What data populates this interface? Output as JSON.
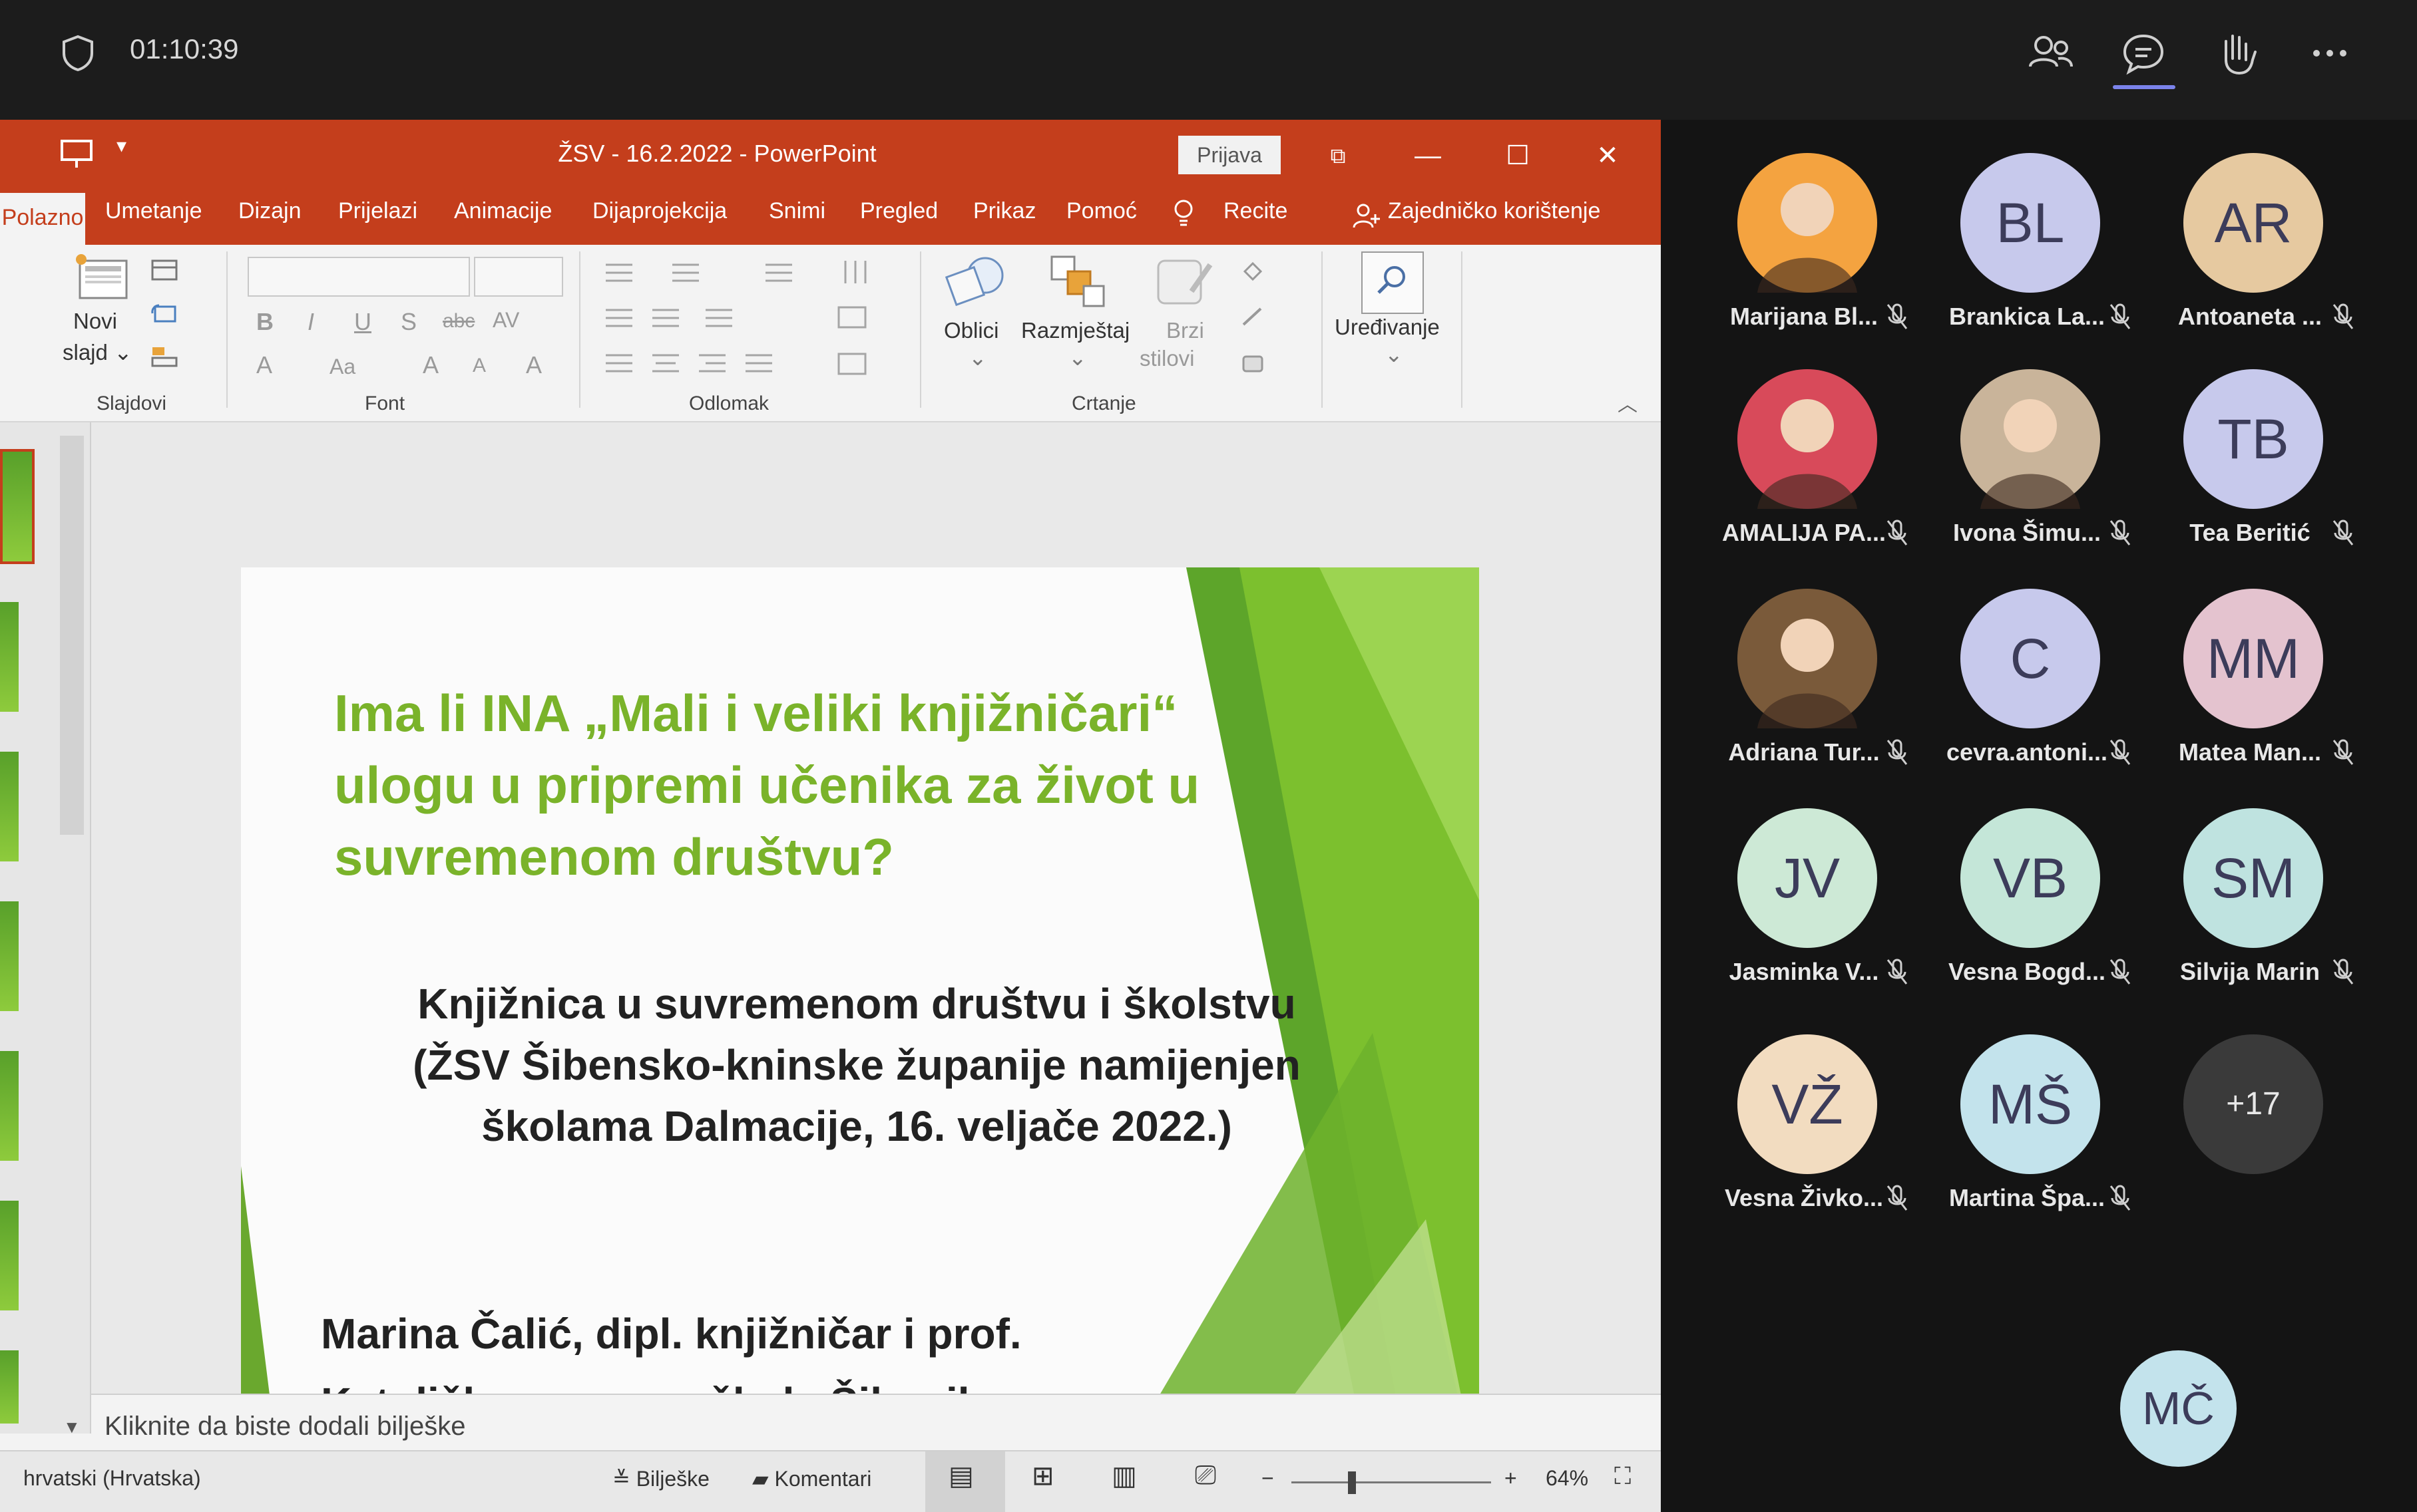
{
  "teams": {
    "timer": "01:10:39",
    "top_icons": [
      "people-icon",
      "chat-icon",
      "raise-hand-icon",
      "more-icon"
    ],
    "accent_color": "#7b83eb"
  },
  "ppt": {
    "window_title": "ŽSV - 16.2.2022 - PowerPoint",
    "signin_label": "Prijava",
    "accent_color": "#c43e1c",
    "tabs": [
      "Polazno",
      "Umetanje",
      "Dizajn",
      "Prijelazi",
      "Animacije",
      "Dijaprojekcija",
      "Snimi",
      "Pregled",
      "Prikaz",
      "Pomoć",
      "Recite",
      "Zajedničko korištenje"
    ],
    "ribbon": {
      "new_slide_line1": "Novi",
      "new_slide_line2": "slajd",
      "slides_group": "Slajdovi",
      "font_group": "Font",
      "paragraph_group": "Odlomak",
      "shapes_label": "Oblici",
      "arrange_label": "Razmještaj",
      "quick_styles_line1": "Brzi",
      "quick_styles_line2": "stilovi",
      "drawing_group": "Crtanje",
      "editing_label": "Uređivanje"
    },
    "slide": {
      "title_line1": "Ima li INA „Mali i veliki knjižničari“",
      "title_line2": "ulogu u pripremi učenika za život u",
      "title_line3": "suvremenom društvu?",
      "subtitle_line1": "Knjižnica u suvremenom društvu i školstvu",
      "subtitle_line2": "(ŽSV Šibensko-kninske županije namijenjen",
      "subtitle_line3": "školama Dalmacije, 16. veljače 2022.)",
      "author_line1": "Marina Čalić, dipl. knjižničar i prof.",
      "author_line2": "Katolička osnovna škola Šibenik"
    },
    "notes_placeholder": "Kliknite da biste dodali bilješke",
    "status": {
      "language": "hrvatski (Hrvatska)",
      "notes_button": "Bilješke",
      "comments_button": "Komentari",
      "zoom": "64%"
    }
  },
  "participants": [
    {
      "name": "Marijana Bl...",
      "initials": "",
      "color": "#f4a340",
      "photo": true
    },
    {
      "name": "Brankica La...",
      "initials": "BL",
      "color": "#c7c9ec"
    },
    {
      "name": "Antoaneta ...",
      "initials": "AR",
      "color": "#e6c9a0"
    },
    {
      "name": "AMALIJA PA...",
      "initials": "",
      "color": "#d84a5a",
      "photo": true
    },
    {
      "name": "Ivona Šimu...",
      "initials": "",
      "color": "#c9b49a",
      "photo": true
    },
    {
      "name": "Tea Beritić",
      "initials": "TB",
      "color": "#c7c9ec"
    },
    {
      "name": "Adriana Tur...",
      "initials": "",
      "color": "#7a5a3a",
      "photo": true
    },
    {
      "name": "cevra.antoni...",
      "initials": "C",
      "color": "#c7c9ec"
    },
    {
      "name": "Matea Man...",
      "initials": "MM",
      "color": "#e4c3cf"
    },
    {
      "name": "Jasminka V...",
      "initials": "JV",
      "color": "#cde9d6"
    },
    {
      "name": "Vesna Bogd...",
      "initials": "VB",
      "color": "#c4e6d8"
    },
    {
      "name": "Silvija Marin",
      "initials": "SM",
      "color": "#bfe3e0"
    },
    {
      "name": "Vesna Živko...",
      "initials": "VŽ",
      "color": "#f2dcc0"
    },
    {
      "name": "Martina Špa...",
      "initials": "MŠ",
      "color": "#c3e3ec"
    },
    {
      "name": "",
      "initials": "+17",
      "color": "#3a3a3a"
    }
  ],
  "self_avatar": {
    "initials": "MČ",
    "color": "#c3e3ec"
  }
}
